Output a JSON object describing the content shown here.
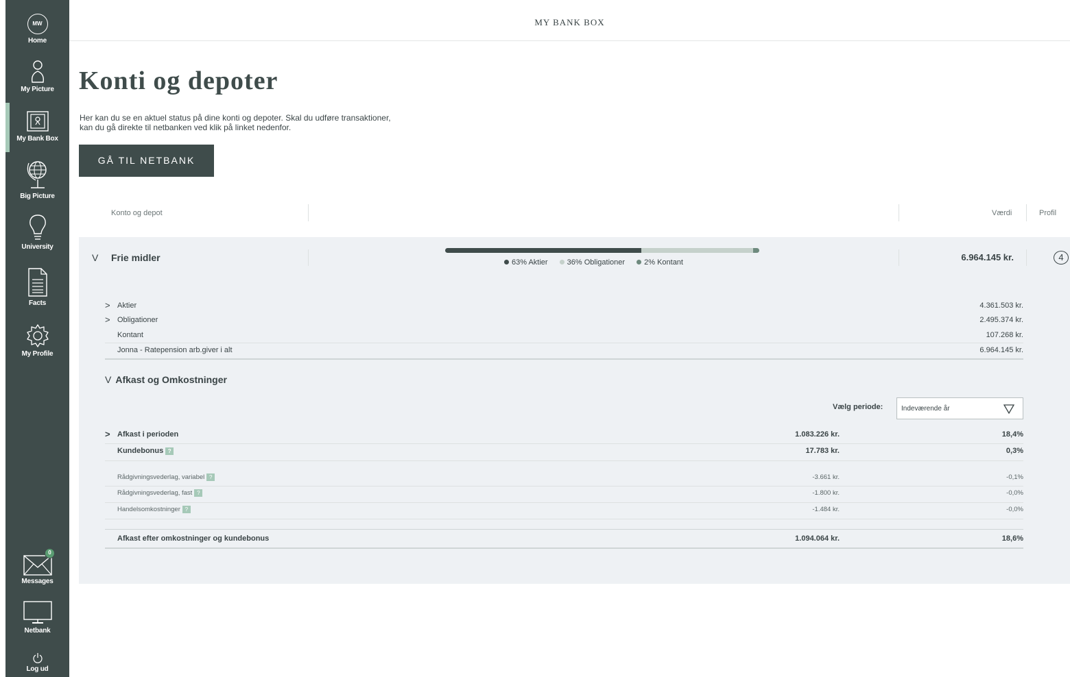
{
  "sidebar": {
    "avatar_initials": "MW",
    "items": [
      {
        "label": "Home",
        "icon": "avatar-icon"
      },
      {
        "label": "My Picture",
        "icon": "person-icon"
      },
      {
        "label": "My Bank Box",
        "icon": "safe-box-icon"
      },
      {
        "label": "Big Picture",
        "icon": "globe-icon"
      },
      {
        "label": "University",
        "icon": "lightbulb-icon"
      },
      {
        "label": "Facts",
        "icon": "document-icon"
      },
      {
        "label": "My Profile",
        "icon": "gear-icon"
      },
      {
        "label": "Messages",
        "icon": "envelope-icon",
        "badge": "0"
      },
      {
        "label": "Netbank",
        "icon": "monitor-icon"
      },
      {
        "label": "Log ud",
        "icon": "power-icon"
      }
    ],
    "active": "My Bank Box"
  },
  "header": {
    "title": "MY BANK BOX"
  },
  "main": {
    "title": "Konti og depoter",
    "intro_line1": "Her kan du se en aktuel status på dine konti og depoter. Skal du udføre transaktioner,",
    "intro_line2": "kan du gå direkte til netbanken ved klik på linket nedenfor.",
    "netbank_button": "GÅ TIL NETBANK",
    "columns": {
      "account": "Konto og depot",
      "value": "Værdi",
      "profile": "Profil"
    }
  },
  "group": {
    "name": "Frie midler",
    "chevron": "V",
    "total": "6.964.145 kr.",
    "profile": "4",
    "allocation": [
      {
        "label": "63% Aktier",
        "percent": 63,
        "color": "#3f4c4b"
      },
      {
        "label": "36% Obligationer",
        "percent": 36,
        "color": "#c5d1cb"
      },
      {
        "label": "2% Kontant",
        "percent": 2,
        "color": "#6e8a7e"
      }
    ],
    "holdings": [
      {
        "chevron": ">",
        "name": "Aktier",
        "value": "4.361.503 kr."
      },
      {
        "chevron": ">",
        "name": "Obligationer",
        "value": "2.495.374 kr."
      },
      {
        "chevron": "",
        "name": "Kontant",
        "value": "107.268 kr."
      },
      {
        "chevron": "",
        "name": "Jonna - Ratepension arb.giver i alt",
        "value": "6.964.145 kr."
      }
    ]
  },
  "returns": {
    "chevron": "V",
    "title": "Afkast og Omkostninger",
    "period_label": "Vælg periode:",
    "period_value": "Indeværende år",
    "rows": [
      {
        "chevron": ">",
        "name": "Afkast i perioden",
        "amount": "1.083.226 kr.",
        "pct": "18,4%"
      },
      {
        "chevron": "",
        "name": "Kundebonus",
        "amount": "17.783 kr.",
        "pct": "0,3%",
        "info": "?"
      },
      {
        "chevron": "",
        "name": "Rådgivningsvederlag, variabel",
        "amount": "-3.661 kr.",
        "pct": "-0,1%",
        "info": "?"
      },
      {
        "chevron": "",
        "name": "Rådgivningsvederlag, fast",
        "amount": "-1.800 kr.",
        "pct": "-0,0%",
        "info": "?"
      },
      {
        "chevron": "",
        "name": "Handelsomkostninger",
        "amount": "-1.484 kr.",
        "pct": "-0,0%",
        "info": "?"
      },
      {
        "chevron": "",
        "name": "Afkast efter omkostninger og kundebonus",
        "amount": "1.094.064 kr.",
        "pct": "18,6%"
      }
    ]
  }
}
